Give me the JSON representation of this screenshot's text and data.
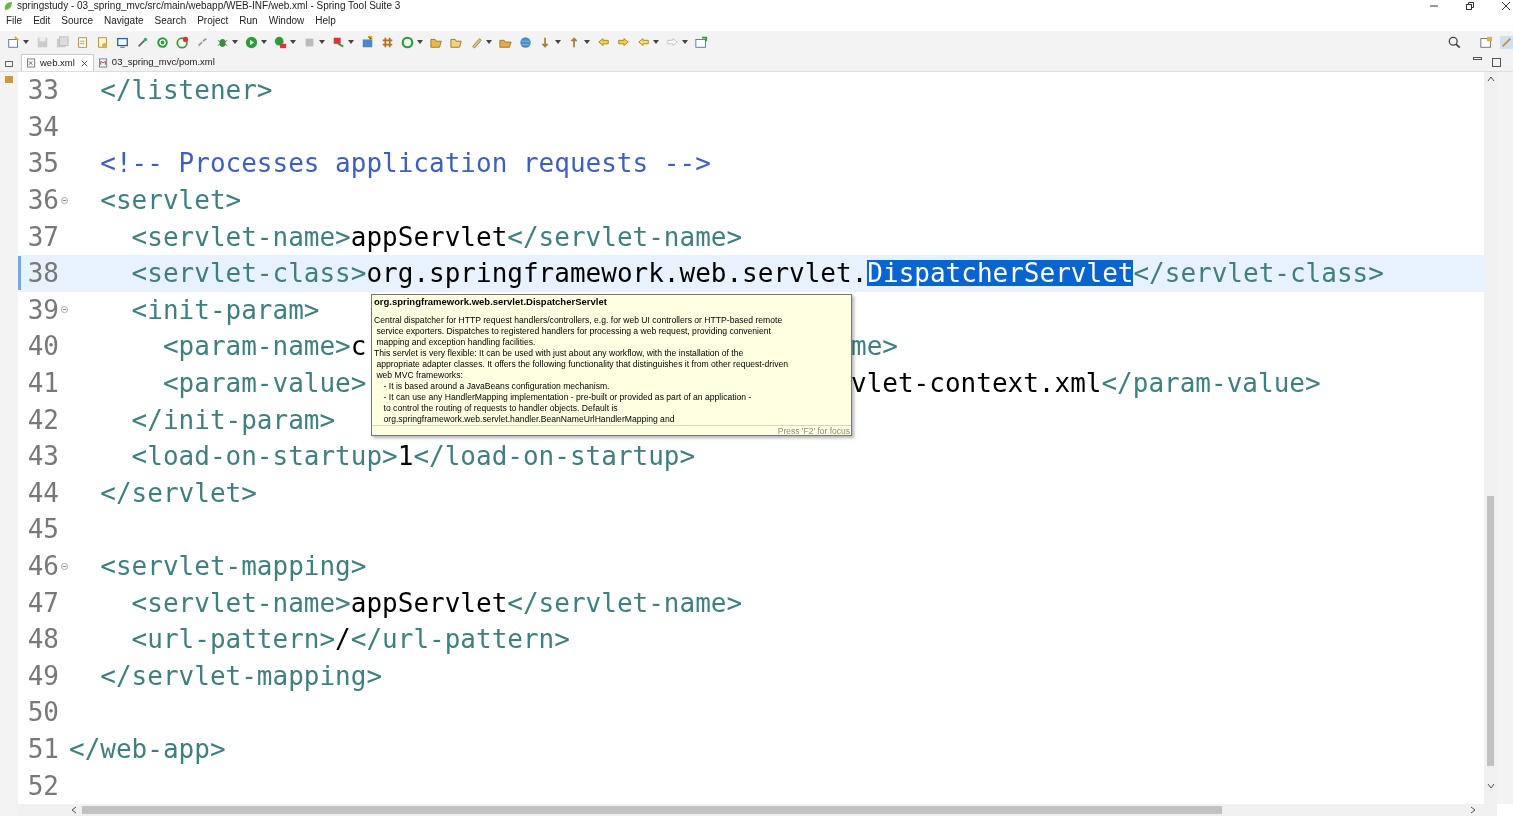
{
  "window": {
    "title": "springstudy - 03_spring_mvc/src/main/webapp/WEB-INF/web.xml - Spring Tool Suite 3"
  },
  "menu": [
    "File",
    "Edit",
    "Source",
    "Navigate",
    "Search",
    "Project",
    "Run",
    "Window",
    "Help"
  ],
  "tabs": [
    {
      "label": "web.xml",
      "kind": "xml",
      "selected": true,
      "closable": true
    },
    {
      "label": "03_spring_mvc/pom.xml",
      "kind": "maven",
      "selected": false,
      "closable": false
    }
  ],
  "editor": {
    "lines": [
      {
        "number": "33",
        "fold": false,
        "current": false,
        "segments": [
          {
            "kind": "tag",
            "text": "  </listener>"
          }
        ]
      },
      {
        "number": "34",
        "fold": false,
        "current": false
      },
      {
        "number": "35",
        "fold": false,
        "current": false,
        "segments": [
          {
            "kind": "comment",
            "text": "  <!-- Processes application requests -->"
          }
        ]
      },
      {
        "number": "36",
        "fold": true,
        "current": false,
        "segments": [
          {
            "kind": "tag",
            "text": "  <servlet>"
          }
        ]
      },
      {
        "number": "37",
        "fold": false,
        "current": false,
        "segments": [
          {
            "kind": "tag",
            "text": "    <servlet-name>"
          },
          {
            "kind": "text",
            "text": "appServlet"
          },
          {
            "kind": "tag",
            "text": "</servlet-name>"
          }
        ]
      },
      {
        "number": "38",
        "fold": false,
        "current": true,
        "segments": [
          {
            "kind": "tag",
            "text": "    <servlet-class>"
          },
          {
            "kind": "text",
            "text": "org.springframework.web.servlet."
          },
          {
            "kind": "selected",
            "text": "DispatcherServlet"
          },
          {
            "kind": "tag",
            "text": "</servlet-class>"
          }
        ]
      },
      {
        "number": "39",
        "fold": true,
        "current": false,
        "segments": [
          {
            "kind": "tag",
            "text": "    <init-param>"
          }
        ]
      },
      {
        "number": "40",
        "fold": false,
        "current": false,
        "segments": [
          {
            "kind": "tag",
            "text": "      <param-name>"
          },
          {
            "kind": "text",
            "text": "c"
          }
        ],
        "after": [
          {
            "kind": "tag",
            "text": "me>"
          }
        ]
      },
      {
        "number": "41",
        "fold": false,
        "current": false,
        "segments": [
          {
            "kind": "tag",
            "text": "      <param-value>"
          }
        ],
        "after": [
          {
            "kind": "text",
            "text": "vlet-context.xml"
          },
          {
            "kind": "tag",
            "text": "</param-value>"
          }
        ]
      },
      {
        "number": "42",
        "fold": false,
        "current": false,
        "segments": [
          {
            "kind": "tag",
            "text": "    </init-param>"
          }
        ]
      },
      {
        "number": "43",
        "fold": false,
        "current": false,
        "segments": [
          {
            "kind": "tag",
            "text": "    <load-on-startup>"
          },
          {
            "kind": "text",
            "text": "1"
          },
          {
            "kind": "tag",
            "text": "</load-on-startup>"
          }
        ]
      },
      {
        "number": "44",
        "fold": false,
        "current": false,
        "segments": [
          {
            "kind": "tag",
            "text": "  </servlet>"
          }
        ]
      },
      {
        "number": "45",
        "fold": false,
        "current": false
      },
      {
        "number": "46",
        "fold": true,
        "current": false,
        "segments": [
          {
            "kind": "tag",
            "text": "  <servlet-mapping>"
          }
        ]
      },
      {
        "number": "47",
        "fold": false,
        "current": false,
        "segments": [
          {
            "kind": "tag",
            "text": "    <servlet-name>"
          },
          {
            "kind": "text",
            "text": "appServlet"
          },
          {
            "kind": "tag",
            "text": "</servlet-name>"
          }
        ]
      },
      {
        "number": "48",
        "fold": false,
        "current": false,
        "segments": [
          {
            "kind": "tag",
            "text": "    <url-pattern>"
          },
          {
            "kind": "text",
            "text": "/"
          },
          {
            "kind": "tag",
            "text": "</url-pattern>"
          }
        ]
      },
      {
        "number": "49",
        "fold": false,
        "current": false,
        "segments": [
          {
            "kind": "tag",
            "text": "  </servlet-mapping>"
          }
        ]
      },
      {
        "number": "50",
        "fold": false,
        "current": false
      },
      {
        "number": "51",
        "fold": false,
        "current": false,
        "segments": [
          {
            "kind": "tag",
            "text": "</web-app>"
          }
        ]
      },
      {
        "number": "52",
        "fold": false,
        "current": false
      }
    ]
  },
  "tooltip": {
    "title": "org.springframework.web.servlet.DispatcherServlet",
    "body": [
      "Central dispatcher for HTTP request handlers/controllers, e.g. for web UI controllers or HTTP-based remote",
      " service exporters. Dispatches to registered handlers for processing a web request, providing convenient",
      " mapping and exception handling facilities.",
      "This servlet is very flexible: It can be used with just about any workflow, with the installation of the",
      " appropriate adapter classes. It offers the following functionality that distinguishes it from other request-driven",
      " web MVC frameworks:",
      "    - It is based around a JavaBeans configuration mechanism.",
      "    - It can use any HandlerMapping implementation - pre-built or provided as part of an application -",
      "    to control the routing of requests to handler objects. Default is",
      "    org.springframework.web.servlet.handler.BeanNameUrlHandlerMapping and"
    ],
    "footer": "Press 'F2' for focus"
  }
}
